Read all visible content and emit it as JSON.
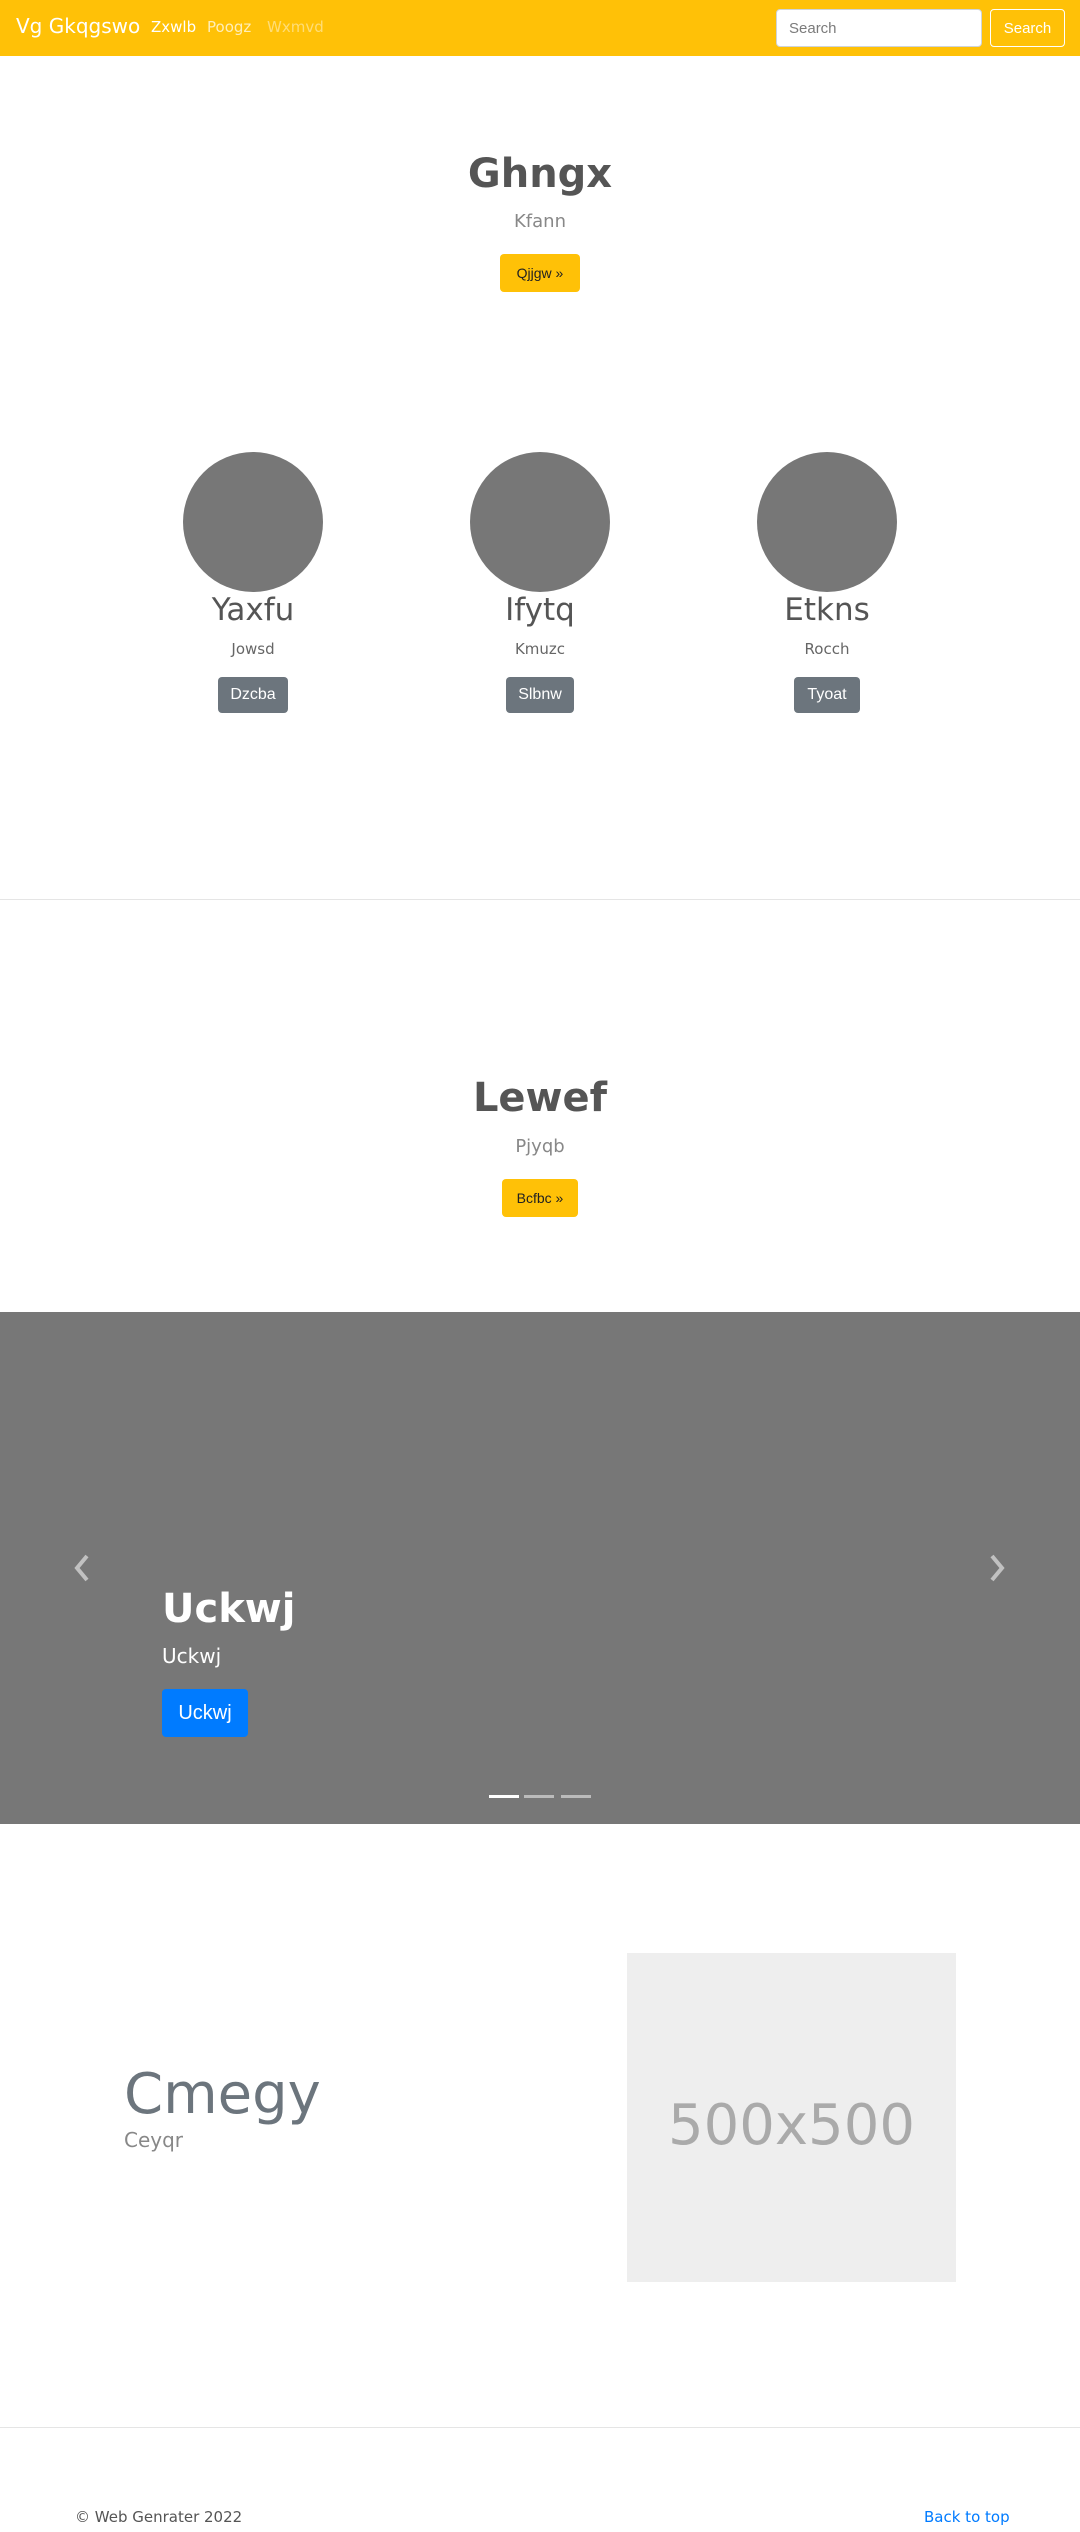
{
  "navbar": {
    "brand": "Vg Gkqgswo",
    "links": [
      "Zxwlb",
      "Poogz",
      "Wxmvd"
    ],
    "search_placeholder": "Search",
    "search_button": "Search"
  },
  "hero": {
    "title": "Ghngx",
    "subtitle": "Kfann",
    "button": "Qjjgw »"
  },
  "features": [
    {
      "title": "Yaxfu",
      "subtitle": "Jowsd",
      "button": "Dzcba"
    },
    {
      "title": "Ifytq",
      "subtitle": "Kmuzc",
      "button": "Slbnw"
    },
    {
      "title": "Etkns",
      "subtitle": "Rocch",
      "button": "Tyoat"
    }
  ],
  "hero2": {
    "title": "Lewef",
    "subtitle": "Pjyqb",
    "button": "Bcfbc »"
  },
  "carousel": {
    "title": "Uckwj",
    "subtitle": "Uckwj",
    "button": "Uckwj",
    "indicators": 3,
    "active_index": 0
  },
  "featurette": {
    "title": "Cmegy",
    "subtitle": "Ceyqr",
    "image_label": "500x500"
  },
  "footer": {
    "copyright": "© Web Genrater 2022",
    "back_to_top": "Back to top"
  },
  "colors": {
    "navbar": "#ffc107",
    "primary": "#007bff",
    "secondary": "#6c757d",
    "carousel_bg": "#777777"
  }
}
